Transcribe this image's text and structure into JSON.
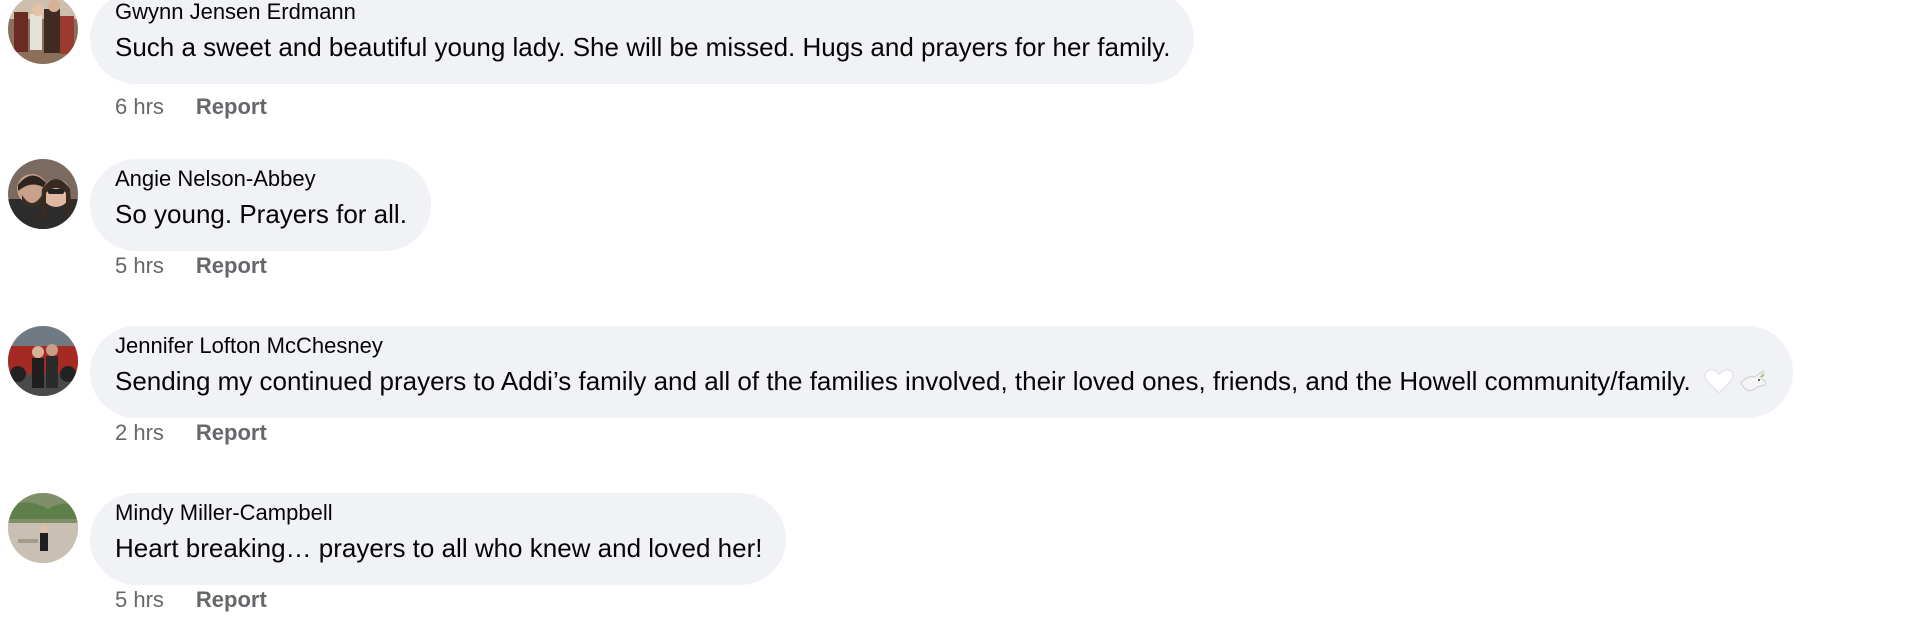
{
  "comments": [
    {
      "author": "Gwynn Jensen Erdmann",
      "text": "Such a sweet and beautiful young lady. She will be missed. Hugs and prayers for her family.",
      "time": "6 hrs",
      "report": "Report"
    },
    {
      "author": "Angie Nelson-Abbey",
      "text": "So young. Prayers for all.",
      "time": "5 hrs",
      "report": "Report"
    },
    {
      "author": "Jennifer Lofton McChesney",
      "text": "Sending my continued prayers to Addi’s family and all of the families involved, their loved ones, friends, and the Howell community/family.",
      "emojis": [
        "white-heart-icon",
        "dove-icon"
      ],
      "time": "2 hrs",
      "report": "Report"
    },
    {
      "author": "Mindy Miller-Campbell",
      "text": "Heart breaking… prayers to all who knew and loved her!",
      "time": "5 hrs",
      "report": "Report"
    }
  ],
  "colors": {
    "bubble": "#f0f2f5",
    "meta": "#65676b",
    "text": "#050505"
  }
}
